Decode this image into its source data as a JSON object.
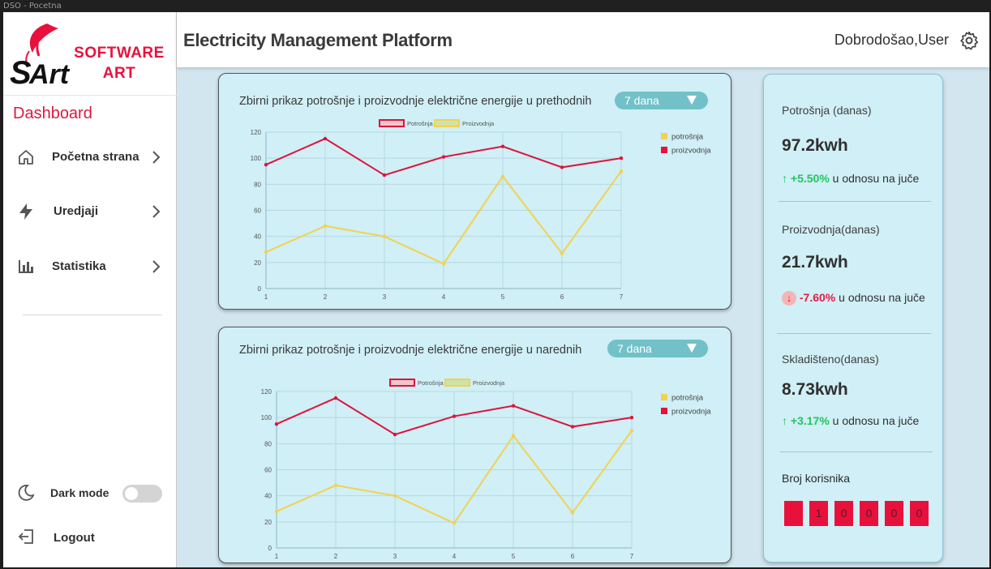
{
  "window": {
    "title": "DSO - Pocetna"
  },
  "brand": {
    "line1": "SOFTWARE",
    "line2": "ART",
    "mark_text": "SArt",
    "color": "#e8113c"
  },
  "sidebar": {
    "dashboard_label": "Dashboard",
    "items": [
      {
        "label": "Početna strana",
        "icon": "home-icon"
      },
      {
        "label": "Uredjaji",
        "icon": "lightning-icon"
      },
      {
        "label": "Statistika",
        "icon": "bar-chart-icon"
      }
    ],
    "dark_mode_label": "Dark mode",
    "dark_mode_on": false,
    "logout_label": "Logout"
  },
  "header": {
    "title": "Electricity Management Platform",
    "welcome": "Dobrodošao,User",
    "settings_icon": "gear-icon"
  },
  "cards": [
    {
      "title": "Zbirni prikaz potrošnje i proizvodnje električne energije u prethodnih",
      "select_value": "7 dana"
    },
    {
      "title": "Zbirni prikaz potrošnje i proizvodnje električne energije u narednih",
      "select_value": "7 dana"
    }
  ],
  "chart_data": [
    {
      "type": "line",
      "x": [
        1,
        2,
        3,
        4,
        5,
        6,
        7
      ],
      "series": [
        {
          "name": "Potrošnja",
          "color": "#dc143c",
          "values": [
            95,
            115,
            87,
            101,
            109,
            93,
            100
          ]
        },
        {
          "name": "Proizvodnja",
          "color": "#f2d24e",
          "values": [
            28,
            48,
            40,
            19,
            86,
            27,
            90
          ]
        }
      ],
      "ylim": [
        0,
        120
      ],
      "yticks": [
        0,
        20,
        40,
        60,
        80,
        100,
        120
      ],
      "grid": true,
      "legend_top": [
        "Potrošnja",
        "Proizvodnja"
      ],
      "legend_right": [
        {
          "label": "potrošnja",
          "color": "#f2d24e"
        },
        {
          "label": "proizvodnja",
          "color": "#e8113c"
        }
      ]
    },
    {
      "type": "line",
      "x": [
        1,
        2,
        3,
        4,
        5,
        6,
        7
      ],
      "series": [
        {
          "name": "Potrošnja",
          "color": "#dc143c",
          "values": [
            95,
            115,
            87,
            101,
            109,
            93,
            100
          ]
        },
        {
          "name": "Proizvodnja",
          "color": "#f2d24e",
          "values": [
            28,
            48,
            40,
            19,
            86,
            27,
            90
          ]
        }
      ],
      "ylim": [
        0,
        120
      ],
      "yticks": [
        0,
        20,
        40,
        60,
        80,
        100,
        120
      ],
      "grid": true,
      "legend_top": [
        "Potrošnja",
        "Proizvodnja"
      ],
      "legend_right": [
        {
          "label": "potrošnja",
          "color": "#f2d24e"
        },
        {
          "label": "proizvodnja",
          "color": "#e8113c"
        }
      ]
    }
  ],
  "stats": {
    "consumption": {
      "label": "Potrošnja (danas)",
      "value": "97.2kwh",
      "change": "+5.50%",
      "suffix": " u odnosu na juče",
      "direction": "up"
    },
    "production": {
      "label": "Proizvodnja(danas)",
      "value": "21.7kwh",
      "change": "-7.60%",
      "suffix": " u odnosu na juče",
      "direction": "down"
    },
    "stored": {
      "label": "Skladišteno(danas)",
      "value": "8.73kwh",
      "change": "+3.17%",
      "suffix": " u odnosu na juče",
      "direction": "up"
    },
    "users": {
      "label": "Broj korisnika",
      "digits": [
        "",
        "1",
        "0",
        "0",
        "0",
        "0"
      ]
    }
  }
}
